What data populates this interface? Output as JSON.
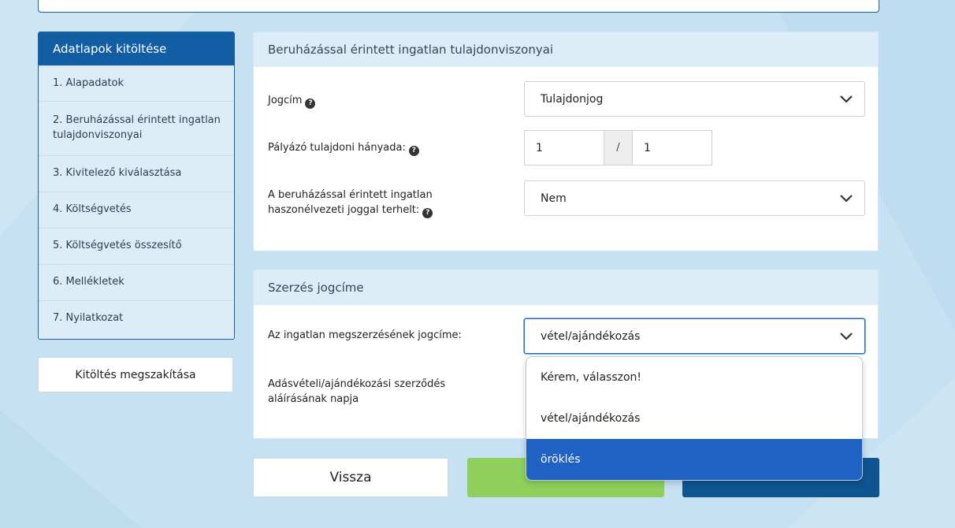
{
  "colors": {
    "background": "#c6e1f1",
    "sidebar_header": "#125ea4",
    "panel_header": "#dcedf8",
    "primary_blue": "#0e5591",
    "green": "#8fcf5b",
    "selected_option": "#1f62c4"
  },
  "sidebar": {
    "title": "Adatlapok kitöltése",
    "items": [
      {
        "label": "1. Alapadatok"
      },
      {
        "label": "2. Beruházással érintett ingatlan tulajdonviszonyai"
      },
      {
        "label": "3. Kivitelező kiválasztása"
      },
      {
        "label": "4. Költségvetés"
      },
      {
        "label": "5. Költségvetés összesítő"
      },
      {
        "label": "6. Mellékletek"
      },
      {
        "label": "7. Nyilatkozat"
      }
    ],
    "abort_label": "Kitöltés megszakítása"
  },
  "ownership": {
    "title": "Beruházással érintett ingatlan tulajdonviszonyai",
    "jogcim_label": "Jogcím",
    "jogcim_value": "Tulajdonjog",
    "share_label": "Pályázó tulajdoni hányada:",
    "share_numerator": "1",
    "share_separator": "/",
    "share_denominator": "1",
    "usufruct_label": "A beruházással érintett ingatlan haszonélvezeti joggal terhelt:",
    "usufruct_value": "Nem"
  },
  "acquisition": {
    "title": "Szerzés jogcíme",
    "method_label": "Az ingatlan megszerzésének jogcíme:",
    "method_value": "vétel/ajándékozás",
    "date_label": "Adásvételi/ajándékozási szerződés aláírásának napja",
    "options": [
      {
        "label": "Kérem, válasszon!"
      },
      {
        "label": "vétel/ajándékozás"
      },
      {
        "label": "öröklés"
      }
    ]
  },
  "footer": {
    "back_label": "Vissza"
  },
  "icons": {
    "help": "question-circle-icon",
    "chevron": "chevron-down-icon"
  }
}
